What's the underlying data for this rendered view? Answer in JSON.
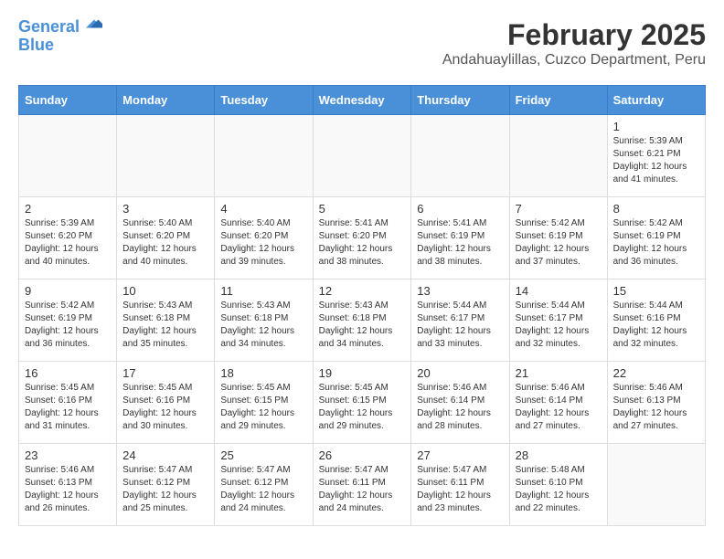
{
  "logo": {
    "line1": "General",
    "line2": "Blue"
  },
  "header": {
    "month_year": "February 2025",
    "location": "Andahuaylillas, Cuzco Department, Peru"
  },
  "days_of_week": [
    "Sunday",
    "Monday",
    "Tuesday",
    "Wednesday",
    "Thursday",
    "Friday",
    "Saturday"
  ],
  "weeks": [
    [
      {
        "day": "",
        "text": ""
      },
      {
        "day": "",
        "text": ""
      },
      {
        "day": "",
        "text": ""
      },
      {
        "day": "",
        "text": ""
      },
      {
        "day": "",
        "text": ""
      },
      {
        "day": "",
        "text": ""
      },
      {
        "day": "1",
        "text": "Sunrise: 5:39 AM\nSunset: 6:21 PM\nDaylight: 12 hours and 41 minutes."
      }
    ],
    [
      {
        "day": "2",
        "text": "Sunrise: 5:39 AM\nSunset: 6:20 PM\nDaylight: 12 hours and 40 minutes."
      },
      {
        "day": "3",
        "text": "Sunrise: 5:40 AM\nSunset: 6:20 PM\nDaylight: 12 hours and 40 minutes."
      },
      {
        "day": "4",
        "text": "Sunrise: 5:40 AM\nSunset: 6:20 PM\nDaylight: 12 hours and 39 minutes."
      },
      {
        "day": "5",
        "text": "Sunrise: 5:41 AM\nSunset: 6:20 PM\nDaylight: 12 hours and 38 minutes."
      },
      {
        "day": "6",
        "text": "Sunrise: 5:41 AM\nSunset: 6:19 PM\nDaylight: 12 hours and 38 minutes."
      },
      {
        "day": "7",
        "text": "Sunrise: 5:42 AM\nSunset: 6:19 PM\nDaylight: 12 hours and 37 minutes."
      },
      {
        "day": "8",
        "text": "Sunrise: 5:42 AM\nSunset: 6:19 PM\nDaylight: 12 hours and 36 minutes."
      }
    ],
    [
      {
        "day": "9",
        "text": "Sunrise: 5:42 AM\nSunset: 6:19 PM\nDaylight: 12 hours and 36 minutes."
      },
      {
        "day": "10",
        "text": "Sunrise: 5:43 AM\nSunset: 6:18 PM\nDaylight: 12 hours and 35 minutes."
      },
      {
        "day": "11",
        "text": "Sunrise: 5:43 AM\nSunset: 6:18 PM\nDaylight: 12 hours and 34 minutes."
      },
      {
        "day": "12",
        "text": "Sunrise: 5:43 AM\nSunset: 6:18 PM\nDaylight: 12 hours and 34 minutes."
      },
      {
        "day": "13",
        "text": "Sunrise: 5:44 AM\nSunset: 6:17 PM\nDaylight: 12 hours and 33 minutes."
      },
      {
        "day": "14",
        "text": "Sunrise: 5:44 AM\nSunset: 6:17 PM\nDaylight: 12 hours and 32 minutes."
      },
      {
        "day": "15",
        "text": "Sunrise: 5:44 AM\nSunset: 6:16 PM\nDaylight: 12 hours and 32 minutes."
      }
    ],
    [
      {
        "day": "16",
        "text": "Sunrise: 5:45 AM\nSunset: 6:16 PM\nDaylight: 12 hours and 31 minutes."
      },
      {
        "day": "17",
        "text": "Sunrise: 5:45 AM\nSunset: 6:16 PM\nDaylight: 12 hours and 30 minutes."
      },
      {
        "day": "18",
        "text": "Sunrise: 5:45 AM\nSunset: 6:15 PM\nDaylight: 12 hours and 29 minutes."
      },
      {
        "day": "19",
        "text": "Sunrise: 5:45 AM\nSunset: 6:15 PM\nDaylight: 12 hours and 29 minutes."
      },
      {
        "day": "20",
        "text": "Sunrise: 5:46 AM\nSunset: 6:14 PM\nDaylight: 12 hours and 28 minutes."
      },
      {
        "day": "21",
        "text": "Sunrise: 5:46 AM\nSunset: 6:14 PM\nDaylight: 12 hours and 27 minutes."
      },
      {
        "day": "22",
        "text": "Sunrise: 5:46 AM\nSunset: 6:13 PM\nDaylight: 12 hours and 27 minutes."
      }
    ],
    [
      {
        "day": "23",
        "text": "Sunrise: 5:46 AM\nSunset: 6:13 PM\nDaylight: 12 hours and 26 minutes."
      },
      {
        "day": "24",
        "text": "Sunrise: 5:47 AM\nSunset: 6:12 PM\nDaylight: 12 hours and 25 minutes."
      },
      {
        "day": "25",
        "text": "Sunrise: 5:47 AM\nSunset: 6:12 PM\nDaylight: 12 hours and 24 minutes."
      },
      {
        "day": "26",
        "text": "Sunrise: 5:47 AM\nSunset: 6:11 PM\nDaylight: 12 hours and 24 minutes."
      },
      {
        "day": "27",
        "text": "Sunrise: 5:47 AM\nSunset: 6:11 PM\nDaylight: 12 hours and 23 minutes."
      },
      {
        "day": "28",
        "text": "Sunrise: 5:48 AM\nSunset: 6:10 PM\nDaylight: 12 hours and 22 minutes."
      },
      {
        "day": "",
        "text": ""
      }
    ]
  ]
}
